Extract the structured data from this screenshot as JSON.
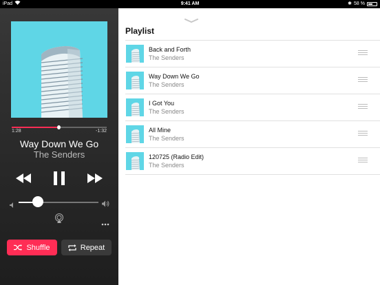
{
  "status_bar": {
    "device": "iPad",
    "time": "9:41 AM",
    "battery_percent": "58 %",
    "battery_level": 0.58
  },
  "now_playing": {
    "elapsed": "1:28",
    "remaining": "-1:32",
    "progress": 0.49,
    "title": "Way Down We Go",
    "artist": "The Senders",
    "volume": 0.24,
    "shuffle_label": "Shuffle",
    "repeat_label": "Repeat"
  },
  "playlist": {
    "title": "Playlist",
    "items": [
      {
        "title": "Back and Forth",
        "artist": "The Senders"
      },
      {
        "title": "Way Down We Go",
        "artist": "The Senders"
      },
      {
        "title": "I Got You",
        "artist": "The Senders"
      },
      {
        "title": "All Mine",
        "artist": "The Senders"
      },
      {
        "title": "120725 (Radio Edit)",
        "artist": "The Senders"
      }
    ]
  },
  "colors": {
    "accent": "#ff2d55",
    "artwork_bg": "#5fd6e6"
  }
}
